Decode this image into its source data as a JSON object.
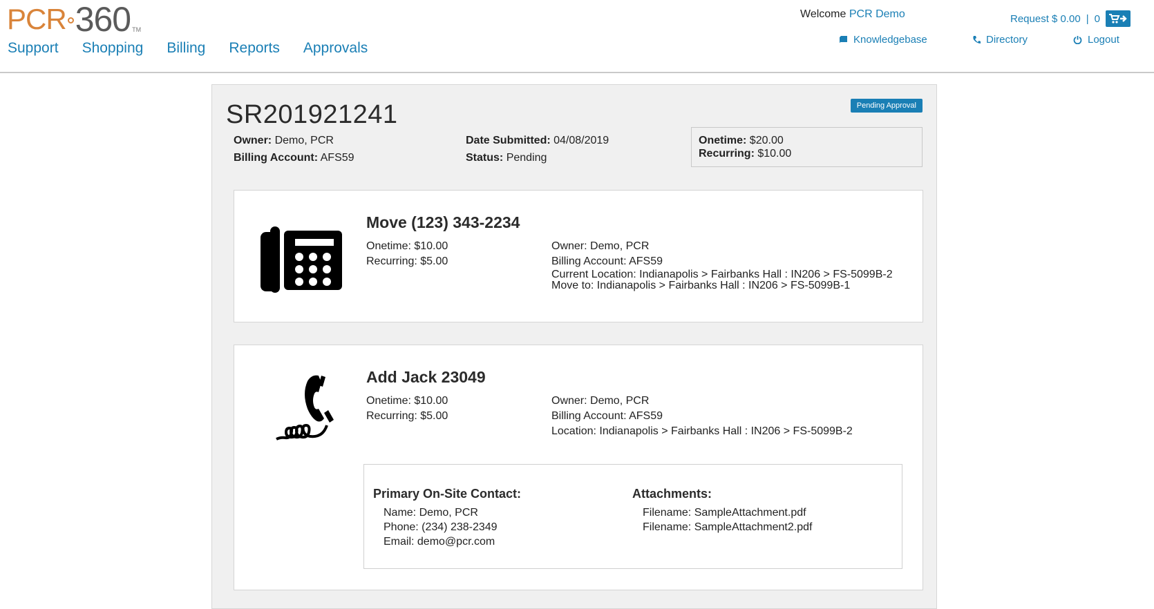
{
  "logo": {
    "part1": "PCR",
    "part2": "360",
    "tm": "TM"
  },
  "nav": {
    "items": [
      "Support",
      "Shopping",
      "Billing",
      "Reports",
      "Approvals"
    ]
  },
  "header": {
    "welcome_label": "Welcome",
    "user_name": "PCR Demo",
    "cart_label": "Request $ 0.00",
    "cart_separator": "|",
    "cart_count": "0",
    "links": {
      "knowledgebase": "Knowledgebase",
      "directory": "Directory",
      "logout": "Logout"
    }
  },
  "request": {
    "id": "SR201921241",
    "status_badge": "Pending Approval",
    "owner_label": "Owner:",
    "owner": "Demo, PCR",
    "billing_label": "Billing Account:",
    "billing": "AFS59",
    "date_label": "Date Submitted:",
    "date": "04/08/2019",
    "status_label": "Status:",
    "status": "Pending",
    "onetime_label": "Onetime:",
    "onetime": "$20.00",
    "recurring_label": "Recurring:",
    "recurring": "$10.00"
  },
  "items": [
    {
      "icon": "desk-phone-icon",
      "title": "Move (123) 343-2234",
      "onetime": "Onetime: $10.00",
      "recurring": "Recurring: $5.00",
      "owner": "Owner: Demo, PCR",
      "billing": "Billing Account: AFS59",
      "location": "Current Location: Indianapolis > Fairbanks Hall : IN206 > FS-5099B-2",
      "move_to": "Move to: Indianapolis > Fairbanks Hall : IN206 > FS-5099B-1"
    },
    {
      "icon": "phone-jack-icon",
      "title": "Add Jack 23049",
      "onetime": "Onetime: $10.00",
      "recurring": "Recurring: $5.00",
      "owner": "Owner: Demo, PCR",
      "billing": "Billing Account: AFS59",
      "location": "Location: Indianapolis > Fairbanks Hall : IN206 > FS-5099B-2",
      "contact": {
        "heading": "Primary On-Site Contact:",
        "name": "Name: Demo, PCR",
        "phone": "Phone: (234) 238-2349",
        "email": "Email: demo@pcr.com"
      },
      "attachments": {
        "heading": "Attachments:",
        "files": [
          "Filename: SampleAttachment.pdf",
          "Filename: SampleAttachment2.pdf"
        ]
      }
    }
  ],
  "colors": {
    "accent": "#1a7fb5",
    "logo_orange": "#d9843a",
    "panel_bg": "#f0f0f0"
  }
}
